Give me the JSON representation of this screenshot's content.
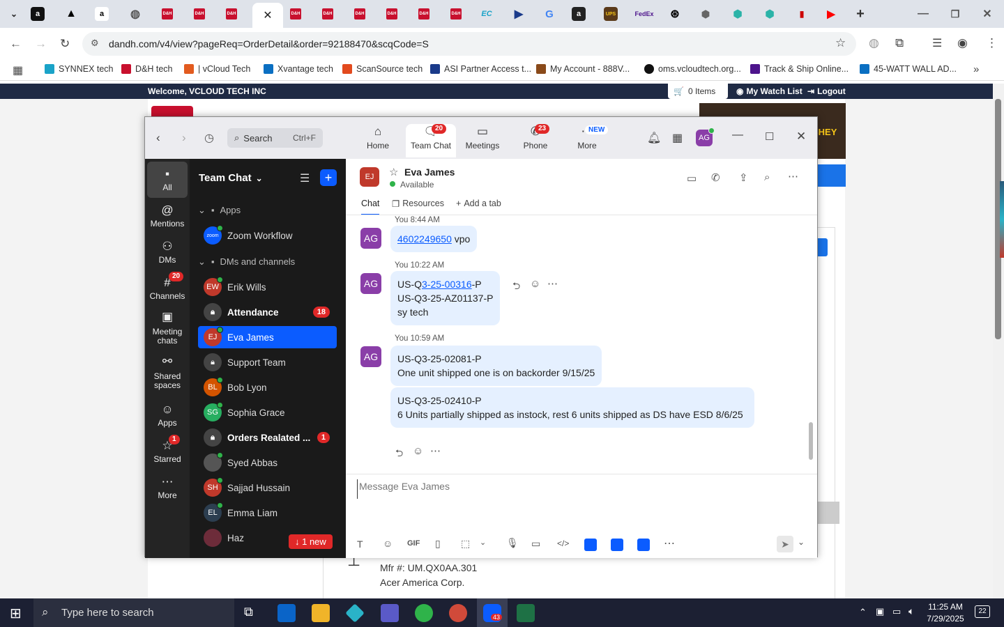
{
  "browser": {
    "url": "dandh.com/v4/view?pageReq=OrderDetail&order=92188470&scqCode=S",
    "bookmarks": [
      {
        "label": "SYNNEX tech",
        "color": "#1aa3c8"
      },
      {
        "label": "D&H tech",
        "color": "#c8102e"
      },
      {
        "label": "| vCloud Tech",
        "color": "#e25b1f"
      },
      {
        "label": "Xvantage tech",
        "color": "#0a6fc2"
      },
      {
        "label": "ScanSource tech",
        "color": "#e24a1e"
      },
      {
        "label": "ASI Partner Access t...",
        "color": "#1a3a8a"
      },
      {
        "label": "My Account - 888V...",
        "color": "#8a4a1a"
      },
      {
        "label": "oms.vcloudtech.org...",
        "color": "#111111"
      },
      {
        "label": "Track & Ship Online...",
        "color": "#4d148c"
      },
      {
        "label": "45-WATT WALL AD...",
        "color": "#0a6fc2"
      }
    ]
  },
  "site": {
    "welcome": "Welcome, VCLOUD TECH INC",
    "cart": "0 Items",
    "watch_list": "My Watch List",
    "logout": "Logout",
    "mfr": "Mfr #: UM.QX0AA.301",
    "vendor": "Acer America Corp."
  },
  "zoom": {
    "nav": {
      "home": "Home",
      "team_chat": "Team Chat",
      "team_chat_badge": "20",
      "meetings": "Meetings",
      "phone": "Phone",
      "phone_badge": "23",
      "more": "More",
      "more_badge": "NEW"
    },
    "search_label": "Search",
    "search_shortcut": "Ctrl+F",
    "user_initials": "AG",
    "rail": [
      {
        "label": "All",
        "badge": ""
      },
      {
        "label": "Mentions",
        "badge": ""
      },
      {
        "label": "DMs",
        "badge": ""
      },
      {
        "label": "Channels",
        "badge": "20"
      },
      {
        "label": "Meeting chats",
        "badge": ""
      },
      {
        "label": "Shared spaces",
        "badge": ""
      },
      {
        "label": "Apps",
        "badge": ""
      },
      {
        "label": "Starred",
        "badge": "1"
      },
      {
        "label": "More",
        "badge": ""
      }
    ],
    "panel_title": "Team Chat",
    "section_apps": "Apps",
    "section_dms": "DMs and channels",
    "channels": [
      {
        "name": "Zoom Workflow",
        "initials": "zoom",
        "color": "#0b5cff",
        "badge": ""
      },
      {
        "name": "Erik Wills",
        "initials": "EW",
        "color": "#c0392b",
        "badge": ""
      },
      {
        "name": "Attendance",
        "initials": "",
        "color": "#444444",
        "badge": "18"
      },
      {
        "name": "Eva James",
        "initials": "EJ",
        "color": "#c0392b",
        "badge": ""
      },
      {
        "name": "Support Team",
        "initials": "",
        "color": "#444444",
        "badge": ""
      },
      {
        "name": "Bob Lyon",
        "initials": "BL",
        "color": "#d35400",
        "badge": ""
      },
      {
        "name": "Sophia Grace",
        "initials": "SG",
        "color": "#27ae60",
        "badge": ""
      },
      {
        "name": "Orders Realated ...",
        "initials": "",
        "color": "#444444",
        "badge": "1"
      },
      {
        "name": "Syed Abbas",
        "initials": "",
        "color": "#555555",
        "badge": ""
      },
      {
        "name": "Sajjad Hussain",
        "initials": "SH",
        "color": "#c0392b",
        "badge": ""
      },
      {
        "name": "Emma Liam",
        "initials": "EL",
        "color": "#2c3e50",
        "badge": ""
      },
      {
        "name": "Haz",
        "initials": "",
        "color": "#6d2c3a",
        "badge": ""
      }
    ],
    "new_pill": "↓ 1 new",
    "contact": {
      "initials": "EJ",
      "name": "Eva James",
      "status": "Available"
    },
    "tabs": {
      "chat": "Chat",
      "resources": "Resources",
      "add": "Add a tab"
    },
    "messages": [
      {
        "meta": "You 8:44 AM",
        "link": "4602249650",
        "text": " vpo"
      },
      {
        "meta": "You 10:22 AM",
        "prefix": "US-Q",
        "link": "3-25-00316",
        "suffix": "-P",
        "line2": "US-Q3-25-AZ01137-P",
        "line3": "sy tech"
      },
      {
        "meta": "You 10:59 AM",
        "line1": "US-Q3-25-02081-P",
        "line2": "One unit shipped one is on backorder 9/15/25"
      },
      {
        "line1": "US-Q3-25-02410-P",
        "line2": "6 Units partially shipped as instock, rest 6 units shipped as DS have ESD 8/6/25"
      }
    ],
    "composer_placeholder": "Message Eva James",
    "gif": "GIF"
  },
  "taskbar": {
    "search": "Type here to search",
    "time": "11:25 AM",
    "date": "7/29/2025",
    "notif": "22",
    "zoom_badge": "43"
  }
}
